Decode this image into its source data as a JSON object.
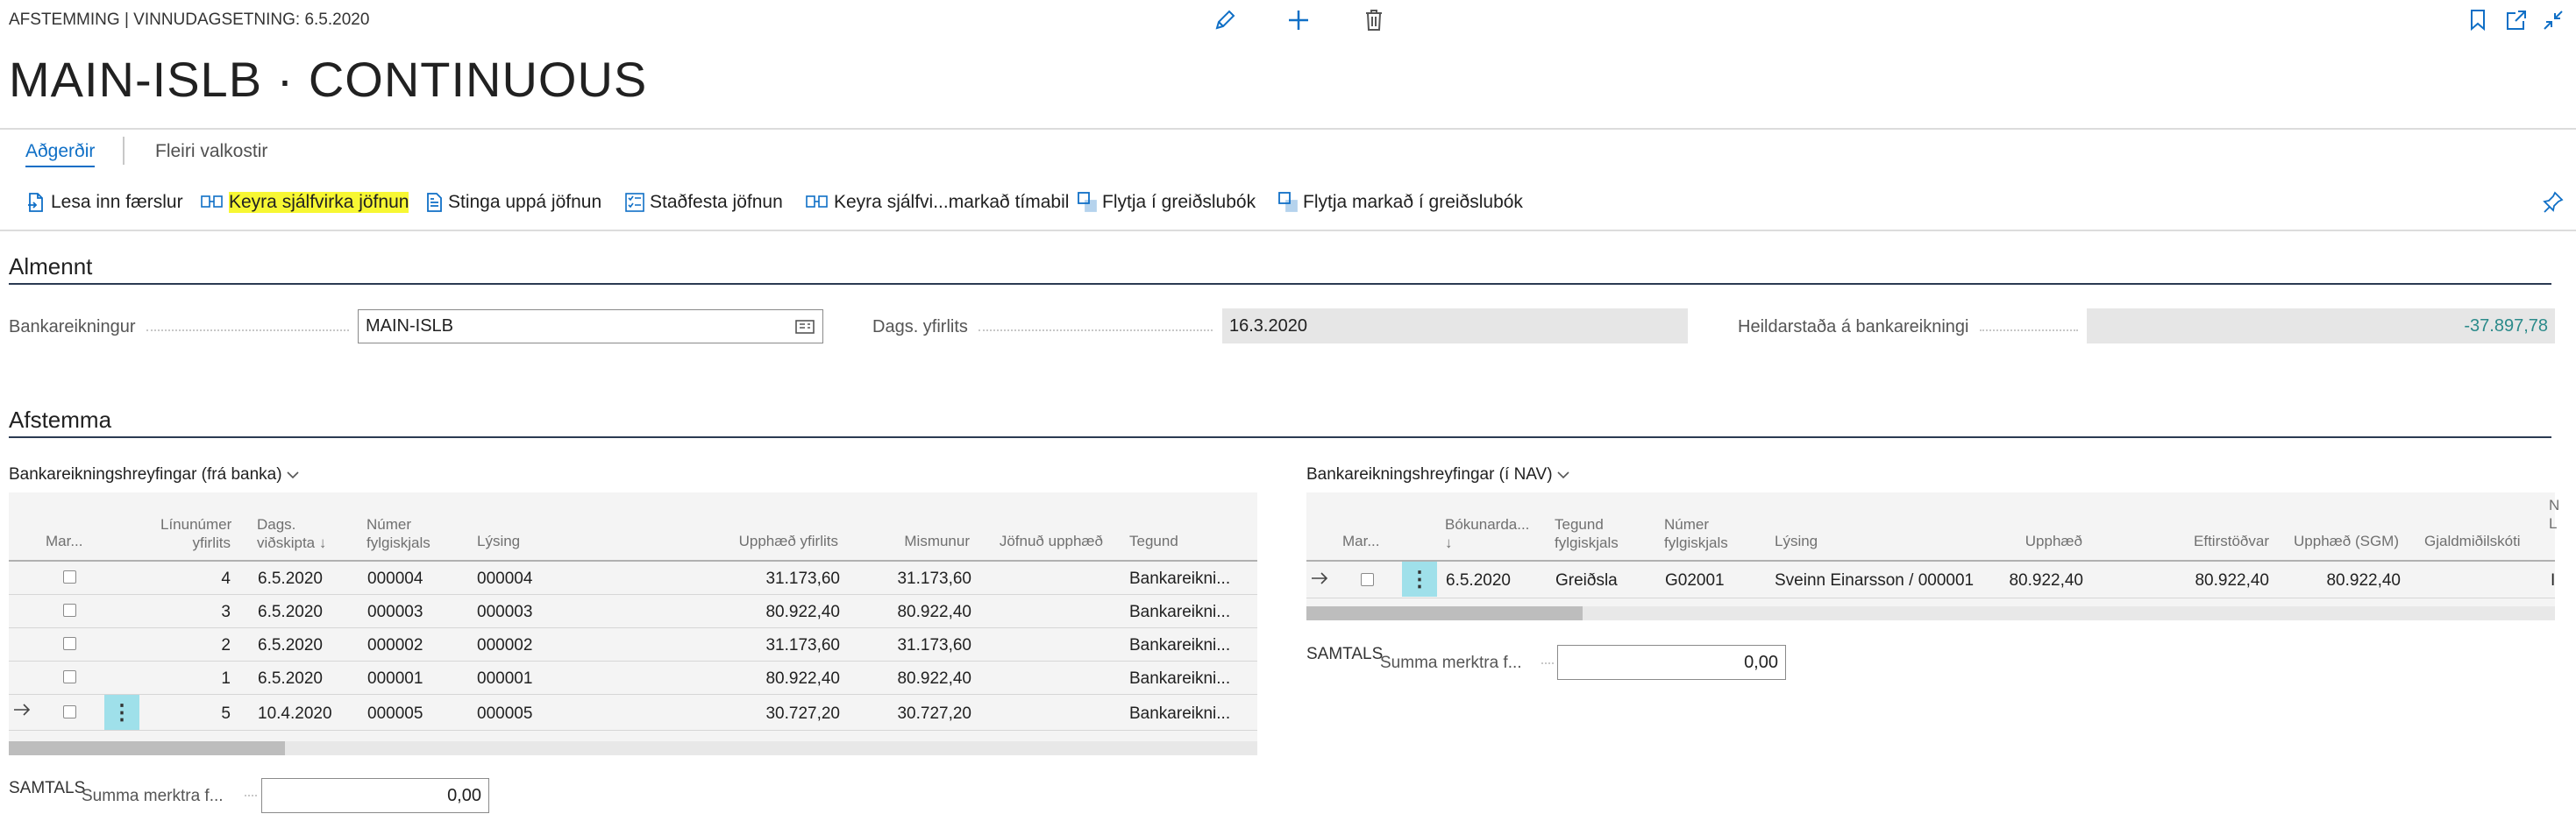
{
  "header": {
    "caption": "AFSTEMMING | VINNUDAGSETNING: 6.5.2020",
    "title": "MAIN-ISLB · CONTINUOUS"
  },
  "tabs": [
    {
      "label": "Aðgerðir",
      "active": true
    },
    {
      "label": "Fleiri valkostir",
      "active": false
    }
  ],
  "actions": [
    {
      "label": "Lesa inn færslur",
      "icon": "import-icon"
    },
    {
      "label": "Keyra sjálfvirka jöfnun",
      "icon": "match-icon"
    },
    {
      "label": "Stinga uppá jöfnun",
      "icon": "suggest-icon"
    },
    {
      "label": "Staðfesta jöfnun",
      "icon": "checklist-icon"
    },
    {
      "label": "Keyra sjálfvi...markað tímabil",
      "icon": "match-icon"
    },
    {
      "label": "Flytja í greiðslubók",
      "icon": "transfer-icon"
    },
    {
      "label": "Flytja markað í greiðslubók",
      "icon": "transfer-icon"
    }
  ],
  "general": {
    "heading": "Almennt",
    "bank_account_label": "Bankareikningur",
    "bank_account_value": "MAIN-ISLB",
    "statement_date_label": "Dags. yfirlits",
    "statement_date_value": "16.3.2020",
    "balance_label": "Heildarstaða á bankareikningi",
    "balance_value": "-37.897,78"
  },
  "reconcile": {
    "heading": "Afstemma",
    "left": {
      "title": "Bankareikningshreyfingar (frá banka)",
      "headers": {
        "mark": "Mar...",
        "line1": "Línunúmer",
        "line2": "yfirlits",
        "date1": "Dags.",
        "date2": "viðskipta",
        "doc1": "Númer",
        "doc2": "fylgiskjals",
        "desc": "Lýsing",
        "amount": "Upphæð yfirlits",
        "diff": "Mismunur",
        "applied": "Jöfnuð upphæð",
        "type": "Tegund"
      },
      "rows": [
        {
          "line": "4",
          "date": "6.5.2020",
          "doc": "000004",
          "desc": "000004",
          "amount": "31.173,60",
          "diff": "31.173,60",
          "type": "Bankareikni..."
        },
        {
          "line": "3",
          "date": "6.5.2020",
          "doc": "000003",
          "desc": "000003",
          "amount": "80.922,40",
          "diff": "80.922,40",
          "type": "Bankareikni..."
        },
        {
          "line": "2",
          "date": "6.5.2020",
          "doc": "000002",
          "desc": "000002",
          "amount": "31.173,60",
          "diff": "31.173,60",
          "type": "Bankareikni..."
        },
        {
          "line": "1",
          "date": "6.5.2020",
          "doc": "000001",
          "desc": "000001",
          "amount": "80.922,40",
          "diff": "80.922,40",
          "type": "Bankareikni..."
        },
        {
          "line": "5",
          "date": "10.4.2020",
          "doc": "000005",
          "desc": "000005",
          "amount": "30.727,20",
          "diff": "30.727,20",
          "type": "Bankareikni..."
        }
      ],
      "total_label": "SAMTALS",
      "sum_label": "Summa merktra f...",
      "sum_value": "0,00"
    },
    "right": {
      "title": "Bankareikningshreyfingar (í NAV)",
      "headers": {
        "mark": "Mar...",
        "post1": "Bókunarda...",
        "type1": "Tegund",
        "type2": "fylgiskjals",
        "doc1": "Númer",
        "doc2": "fylgiskjals",
        "desc": "Lýsing",
        "amount": "Upphæð",
        "remaining": "Eftirstöðvar",
        "amount_lcy": "Upphæð (SGM)",
        "currency": "Gjaldmiðilskóti",
        "extra1": "N",
        "extra2": "L"
      },
      "rows": [
        {
          "date": "6.5.2020",
          "type": "Greiðsla",
          "doc": "G02001",
          "desc": "Sveinn Einarsson / 000001",
          "amount": "80.922,40",
          "remaining": "80.922,40",
          "amount_lcy": "80.922,40",
          "extra": "I"
        }
      ],
      "total_label": "SAMTALS",
      "sum_label": "Summa merktra f...",
      "sum_value": "0,00"
    }
  }
}
